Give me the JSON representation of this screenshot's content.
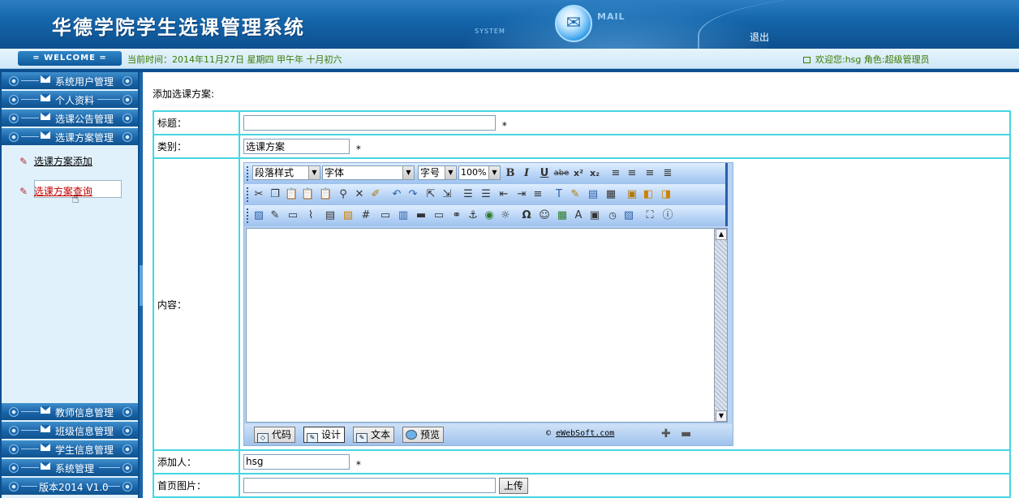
{
  "header": {
    "title": "华德学院学生选课管理系统",
    "system_label": "SYSTEM",
    "mail_label": "MAIL",
    "logout": "退出",
    "mail_icon": "envelope-icon"
  },
  "welcome_bar": {
    "welcome_label": "= WELCOME =",
    "current_time": "当前时间：2014年11月27日 星期四 甲午年 十月初六",
    "user_info": "欢迎您:hsg 角色:超级管理员"
  },
  "sidebar": {
    "top_items": [
      {
        "label": "系统用户管理"
      },
      {
        "label": "个人资料"
      },
      {
        "label": "选课公告管理"
      },
      {
        "label": "选课方案管理"
      }
    ],
    "sub_items": [
      {
        "label": "选课方案添加"
      },
      {
        "label": "选课方案查询"
      }
    ],
    "bottom_items": [
      {
        "label": "教师信息管理"
      },
      {
        "label": "班级信息管理"
      },
      {
        "label": "学生信息管理"
      },
      {
        "label": "系统管理"
      },
      {
        "label": "版本2014 V1.0"
      }
    ]
  },
  "main": {
    "heading": "添加选课方案:",
    "fields": {
      "title_label": "标题：",
      "title_value": "",
      "category_label": "类别：",
      "category_value": "选课方案",
      "content_label": "内容：",
      "author_label": "添加人：",
      "author_value": "hsg",
      "image_label": "首页图片：",
      "image_value": "",
      "upload_button": "上传",
      "required_mark": "*"
    },
    "editor": {
      "paragraph_style": "段落样式",
      "font_family": "字体",
      "font_size": "字号",
      "zoom": "100%",
      "tabs": [
        {
          "label": "代码"
        },
        {
          "label": "设计"
        },
        {
          "label": "文本"
        },
        {
          "label": "预览"
        }
      ],
      "credit": "eWebSoft.com",
      "credit_symbol": "©"
    }
  },
  "colors": {
    "header_blue": "#1566ab",
    "table_border": "#45d6e3",
    "time_text": "#3a7a00",
    "active_link": "#c00000"
  }
}
